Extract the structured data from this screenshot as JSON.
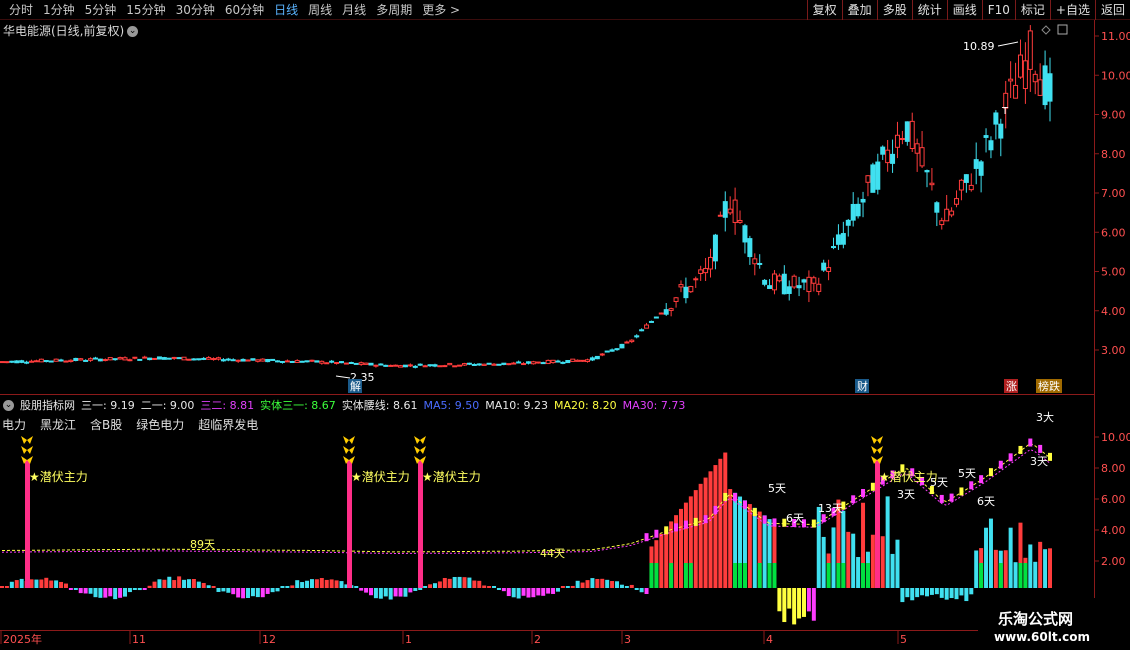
{
  "toolbar": {
    "periods": [
      "分时",
      "1分钟",
      "5分钟",
      "15分钟",
      "30分钟",
      "60分钟",
      "日线",
      "周线",
      "月线",
      "多周期",
      "更多 >"
    ],
    "active_period": "日线",
    "right_buttons": [
      "复权",
      "叠加",
      "多股",
      "统计",
      "画线",
      "F10",
      "标记",
      "+自选",
      "返回"
    ]
  },
  "main_chart": {
    "title": "华电能源(日线,前复权)",
    "y_ticks": [
      "11.00",
      "10.00",
      "9.00",
      "8.00",
      "7.00",
      "6.00",
      "5.00",
      "4.00",
      "3.00"
    ],
    "high_label": "10.89",
    "low_label": "2.35",
    "marker_t": "T",
    "badges": {
      "jie": "解",
      "cai": "财",
      "zhang": "涨",
      "bang": "榜跌"
    }
  },
  "indicator": {
    "name": "股朋指标网",
    "items": [
      {
        "label": "三一: 9.19",
        "color": "#e8e8e8"
      },
      {
        "label": "二一: 9.00",
        "color": "#e8e8e8"
      },
      {
        "label": "三二: 8.81",
        "color": "#e040fb"
      },
      {
        "label": "实体三一: 8.67",
        "color": "#3cff3c"
      },
      {
        "label": "实体腰线: 8.61",
        "color": "#e8e8e8"
      },
      {
        "label": "MA5: 9.50",
        "color": "#4a6cff"
      },
      {
        "label": "MA10: 9.23",
        "color": "#e8e8e8"
      },
      {
        "label": "MA20: 8.20",
        "color": "#ffff40"
      },
      {
        "label": "MA30: 7.73",
        "color": "#e040fb"
      }
    ],
    "sectors": [
      "电力",
      "黑龙江",
      "含B股",
      "绿色电力",
      "超临界发电"
    ],
    "y_ticks": [
      "10.00",
      "8.00",
      "6.00",
      "4.00",
      "2.00"
    ],
    "signal_text": "★潜伏主力",
    "day_labels": [
      "89天",
      "44天",
      "5天",
      "6天",
      "13天",
      "3天",
      "5天",
      "5天",
      "6天",
      "3天",
      "3大"
    ]
  },
  "dates": [
    "2025年",
    "11",
    "12",
    "1",
    "2",
    "3",
    "4",
    "5"
  ],
  "watermark": {
    "name": "乐淘公式网",
    "url": "www.60lt.com"
  },
  "colors": {
    "up": "#ff3c3c",
    "down": "#40e0f0",
    "axis": "#8b1a1a",
    "pink": "#ff3cff",
    "green": "#00e040"
  }
}
